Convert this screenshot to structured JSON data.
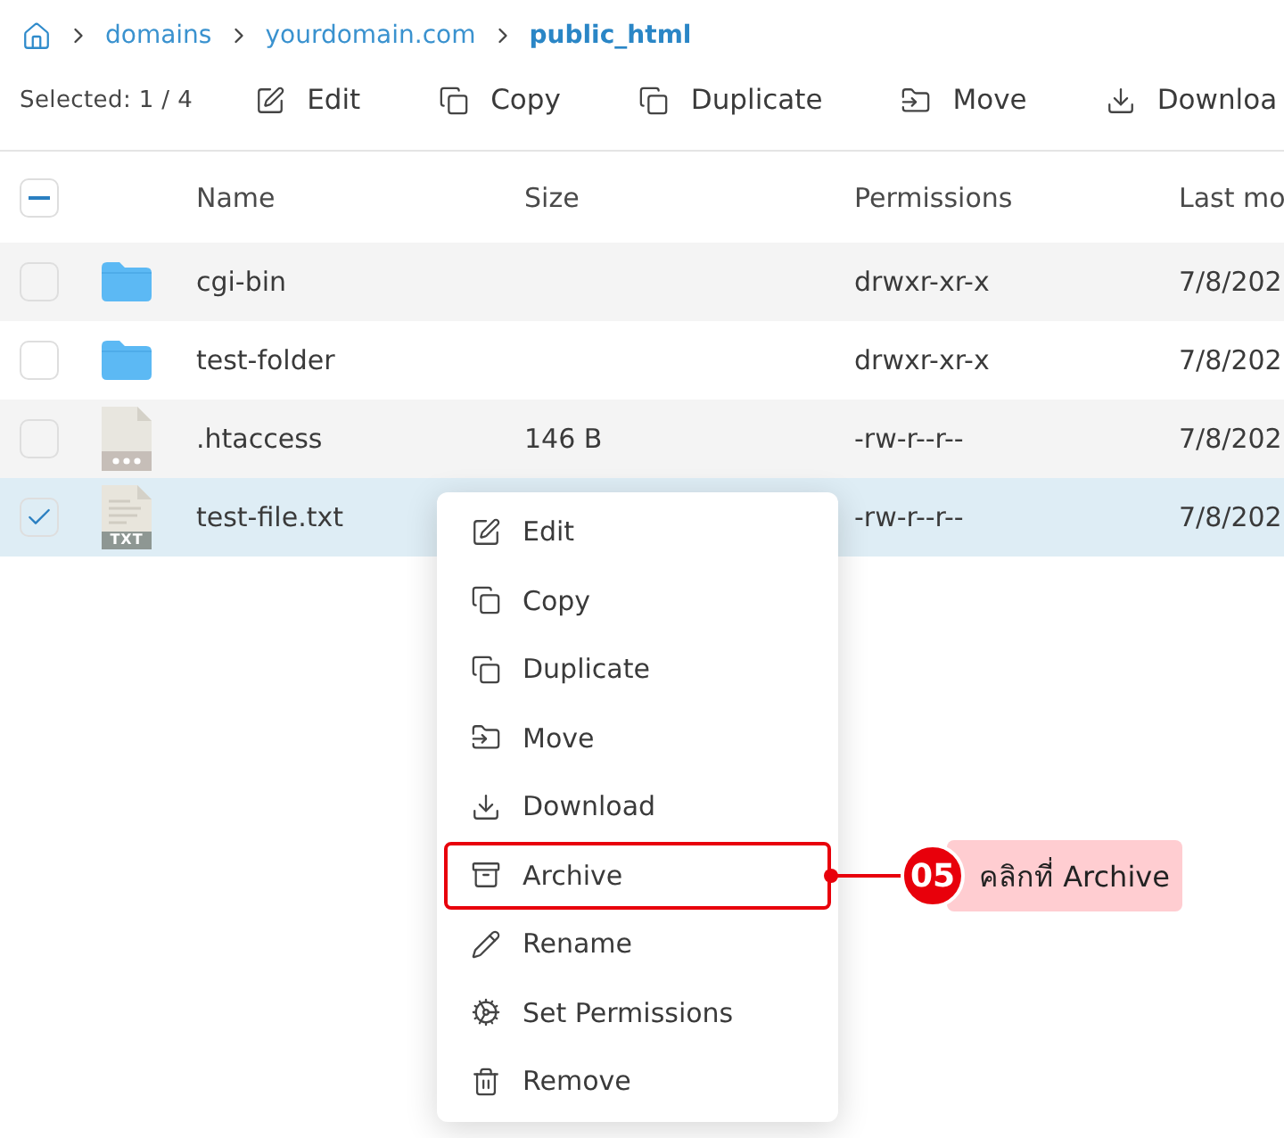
{
  "breadcrumb": {
    "items": [
      {
        "label": "domains",
        "current": false
      },
      {
        "label": "yourdomain.com",
        "current": false
      },
      {
        "label": "public_html",
        "current": true
      }
    ]
  },
  "toolbar": {
    "selection": "Selected: 1 / 4",
    "actions": [
      {
        "label": "Edit",
        "kind": "edit"
      },
      {
        "label": "Copy",
        "kind": "copy"
      },
      {
        "label": "Duplicate",
        "kind": "duplicate"
      },
      {
        "label": "Move",
        "kind": "move"
      },
      {
        "label": "Downloa",
        "kind": "download"
      }
    ]
  },
  "table": {
    "select_all": {
      "indeterminate": true
    },
    "columns": [
      "Name",
      "Size",
      "Permissions",
      "Last mo"
    ],
    "rows": [
      {
        "kind": "folder",
        "name": "cgi-bin",
        "permissions": "drwxr-xr-x",
        "column_4": "7/8/202",
        "checked": false,
        "selected": false
      },
      {
        "kind": "folder",
        "name": "test-folder",
        "permissions": "drwxr-xr-x",
        "column_4": "7/8/202",
        "checked": false,
        "selected": false
      },
      {
        "kind": "file",
        "name": ".htaccess",
        "size": "146 B",
        "permissions": "-rw-r--r--",
        "column_4": "7/8/202",
        "checked": false,
        "selected": false
      },
      {
        "kind": "text_file",
        "badge": "TXT",
        "name": "test-file.txt",
        "permissions": "-rw-r--r--",
        "column_4": "7/8/202",
        "checked": true,
        "selected": true
      }
    ]
  },
  "context_menu": {
    "items": [
      {
        "label": "Edit",
        "kind": "edit",
        "annotated": false
      },
      {
        "label": "Copy",
        "kind": "copy",
        "annotated": false
      },
      {
        "label": "Duplicate",
        "kind": "duplicate",
        "annotated": false
      },
      {
        "label": "Move",
        "kind": "move",
        "annotated": false
      },
      {
        "label": "Download",
        "kind": "download",
        "annotated": false
      },
      {
        "label": "Archive",
        "kind": "archive",
        "annotated": true
      },
      {
        "label": "Rename",
        "kind": "rename",
        "annotated": false
      },
      {
        "label": "Set Permissions",
        "kind": "permissions",
        "annotated": false
      },
      {
        "label": "Remove",
        "kind": "remove",
        "annotated": false
      }
    ]
  },
  "callout": {
    "number": "05",
    "text": "คลิกที่ Archive"
  }
}
